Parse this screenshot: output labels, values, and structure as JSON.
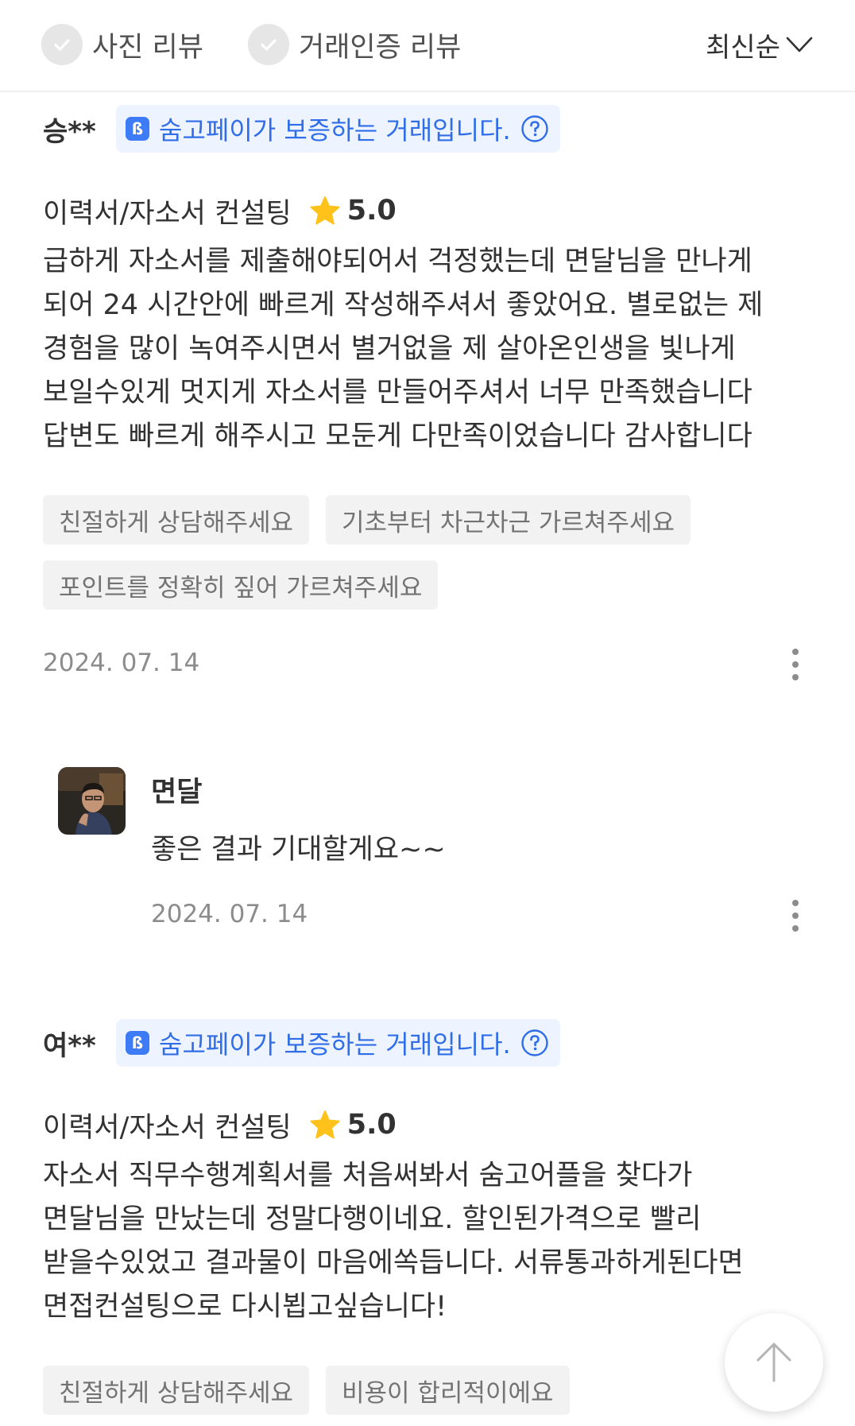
{
  "filters": {
    "photo_review": "사진 리뷰",
    "verified_review": "거래인증 리뷰",
    "sort_label": "최신순"
  },
  "reviews": [
    {
      "author": "승**",
      "badge": "숨고페이가 보증하는 거래입니다.",
      "service": "이력서/자소서 컨설팅",
      "rating": "5.0",
      "body": "급하게 자소서를 제출해야되어서 걱정했는데 면달님을 만나게\n되어 24 시간안에 빠르게 작성해주셔서 좋았어요. 별로없는 제\n경험을 많이 녹여주시면서 별거없을 제 살아온인생을 빛나게\n보일수있게 멋지게 자소서를 만들어주셔서 너무 만족했습니다\n답변도 빠르게 해주시고 모둔게 다만족이었습니다 감사합니다",
      "tags": [
        "친절하게 상담해주세요",
        "기초부터 차근차근 가르쳐주세요",
        "포인트를 정확히 짚어 가르쳐주세요"
      ],
      "date": "2024. 07. 14",
      "reply": {
        "name": "면달",
        "text": "좋은 결과 기대할게요~~",
        "date": "2024. 07. 14"
      }
    },
    {
      "author": "여**",
      "badge": "숨고페이가 보증하는 거래입니다.",
      "service": "이력서/자소서 컨설팅",
      "rating": "5.0",
      "body": "자소서 직무수행계획서를 처음써봐서 숨고어플을 찾다가\n면달님을 만났는데 정말다행이네요. 할인된가격으로 빨리\n받을수있었고 결과물이 마음에쏙듭니다. 서류통과하게된다면\n면접컨설팅으로 다시뵙고싶습니다!",
      "tags": [
        "친절하게 상담해주세요",
        "비용이 합리적이에요"
      ]
    }
  ],
  "colors": {
    "accent_blue": "#2f6ee8",
    "badge_bg": "#eef4ff",
    "star": "#ffc21a",
    "tag_bg": "#f2f2f2"
  },
  "icons": {
    "filter_check": "check-icon",
    "sort": "chevron-down-icon",
    "pay_logo": "soomgo-pay-logo-icon",
    "help": "question-circle-icon",
    "star": "star-icon",
    "more": "more-vertical-icon",
    "scroll_top": "arrow-up-icon"
  }
}
